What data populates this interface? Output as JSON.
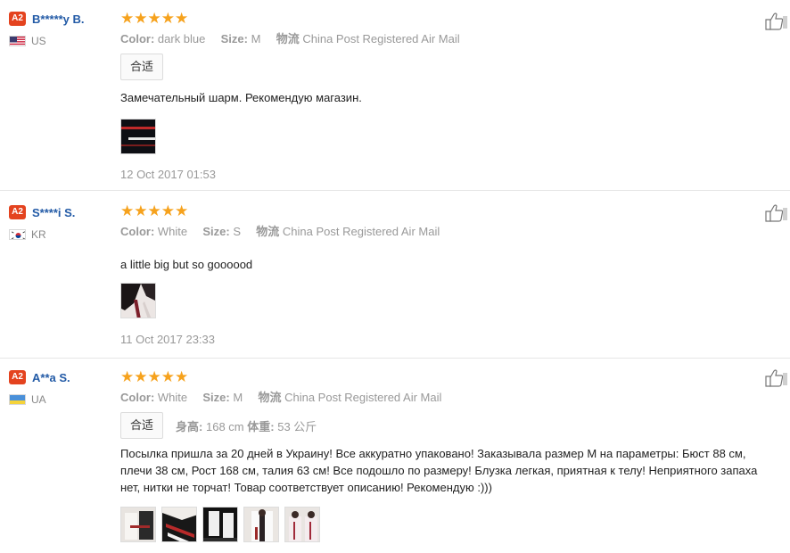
{
  "reviews": [
    {
      "level": "A2",
      "name": "B*****y B.",
      "country": "US",
      "stars": "★★★★★",
      "color_label": "Color:",
      "color_value": "dark blue",
      "size_label": "Size:",
      "size_value": "M",
      "shipping_label": "物流",
      "shipping_value": "China Post Registered Air Mail",
      "fit": "合适",
      "text": "Замечательный шарм. Рекомендую магазин.",
      "date": "12 Oct 2017 01:53",
      "photo_count": 1
    },
    {
      "level": "A2",
      "name": "S****i S.",
      "country": "KR",
      "stars": "★★★★★",
      "color_label": "Color:",
      "color_value": "White",
      "size_label": "Size:",
      "size_value": "S",
      "shipping_label": "物流",
      "shipping_value": "China Post Registered Air Mail",
      "text": "a little big but so goooood",
      "date": "11 Oct 2017 23:33",
      "photo_count": 1
    },
    {
      "level": "A2",
      "name": "A**a S.",
      "country": "UA",
      "stars": "★★★★★",
      "color_label": "Color:",
      "color_value": "White",
      "size_label": "Size:",
      "size_value": "M",
      "shipping_label": "物流",
      "shipping_value": "China Post Registered Air Mail",
      "fit": "合适",
      "height_label": "身高:",
      "height_value": "168 cm",
      "weight_label": "体重:",
      "weight_value": "53 公斤",
      "text": "Посылка пришла за 20 дней в Украину! Все аккуратно упаковано! Заказывала размер M на параметры: Бюст 88 см, плечи 38 см, Рост 168 см, талия 63 см! Все подошло по размеру! Блузка легкая, приятная к телу! Неприятного запаха нет, нитки не торчат! Товар соответствует описанию! Рекомендую :)))",
      "photo_count": 5
    }
  ],
  "colors": {
    "badge": "#e4431f",
    "username": "#225aa6",
    "stars": "#f6a21d",
    "muted": "#999999"
  },
  "icons": {
    "helpful": "thumbs-up-icon"
  }
}
